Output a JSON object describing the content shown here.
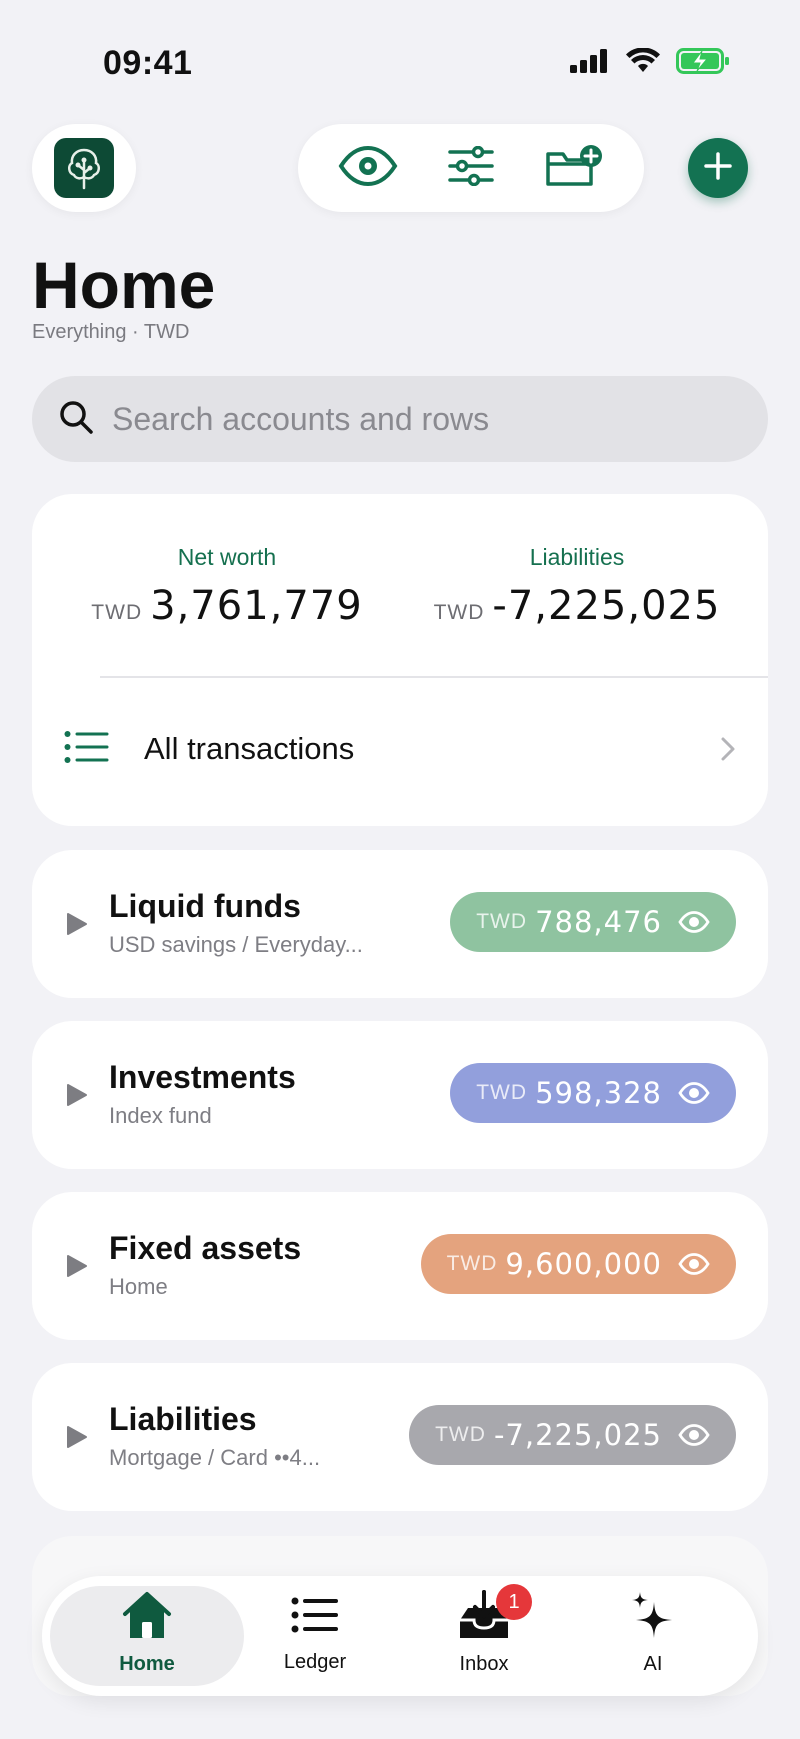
{
  "status_bar": {
    "time": "09:41"
  },
  "header": {
    "title": "Home",
    "subtitle": "Everything · TWD"
  },
  "search": {
    "placeholder": "Search accounts and rows"
  },
  "summary": {
    "net_worth_label": "Net worth",
    "net_worth_currency": "TWD",
    "net_worth_value": "3,761,779",
    "liabilities_label": "Liabilities",
    "liabilities_currency": "TWD",
    "liabilities_value": "-7,225,025",
    "all_transactions_label": "All transactions"
  },
  "groups": [
    {
      "title": "Liquid funds",
      "subtitle": "USD savings / Everyday...",
      "currency": "TWD",
      "amount": "788,476",
      "color": "#8fc3a0"
    },
    {
      "title": "Investments",
      "subtitle": "Index fund",
      "currency": "TWD",
      "amount": "598,328",
      "color": "#929fdc"
    },
    {
      "title": "Fixed assets",
      "subtitle": "Home",
      "currency": "TWD",
      "amount": "9,600,000",
      "color": "#e4a37e"
    },
    {
      "title": "Liabilities",
      "subtitle": "Mortgage / Card ••4...",
      "currency": "TWD",
      "amount": "-7,225,025",
      "color": "#a8a8ad"
    }
  ],
  "tabbar": {
    "home": "Home",
    "ledger": "Ledger",
    "inbox": "Inbox",
    "inbox_badge": "1",
    "ai": "AI"
  },
  "colors": {
    "accent": "#137252",
    "logo_bg": "#0d4a35",
    "badge": "#e5373a"
  }
}
